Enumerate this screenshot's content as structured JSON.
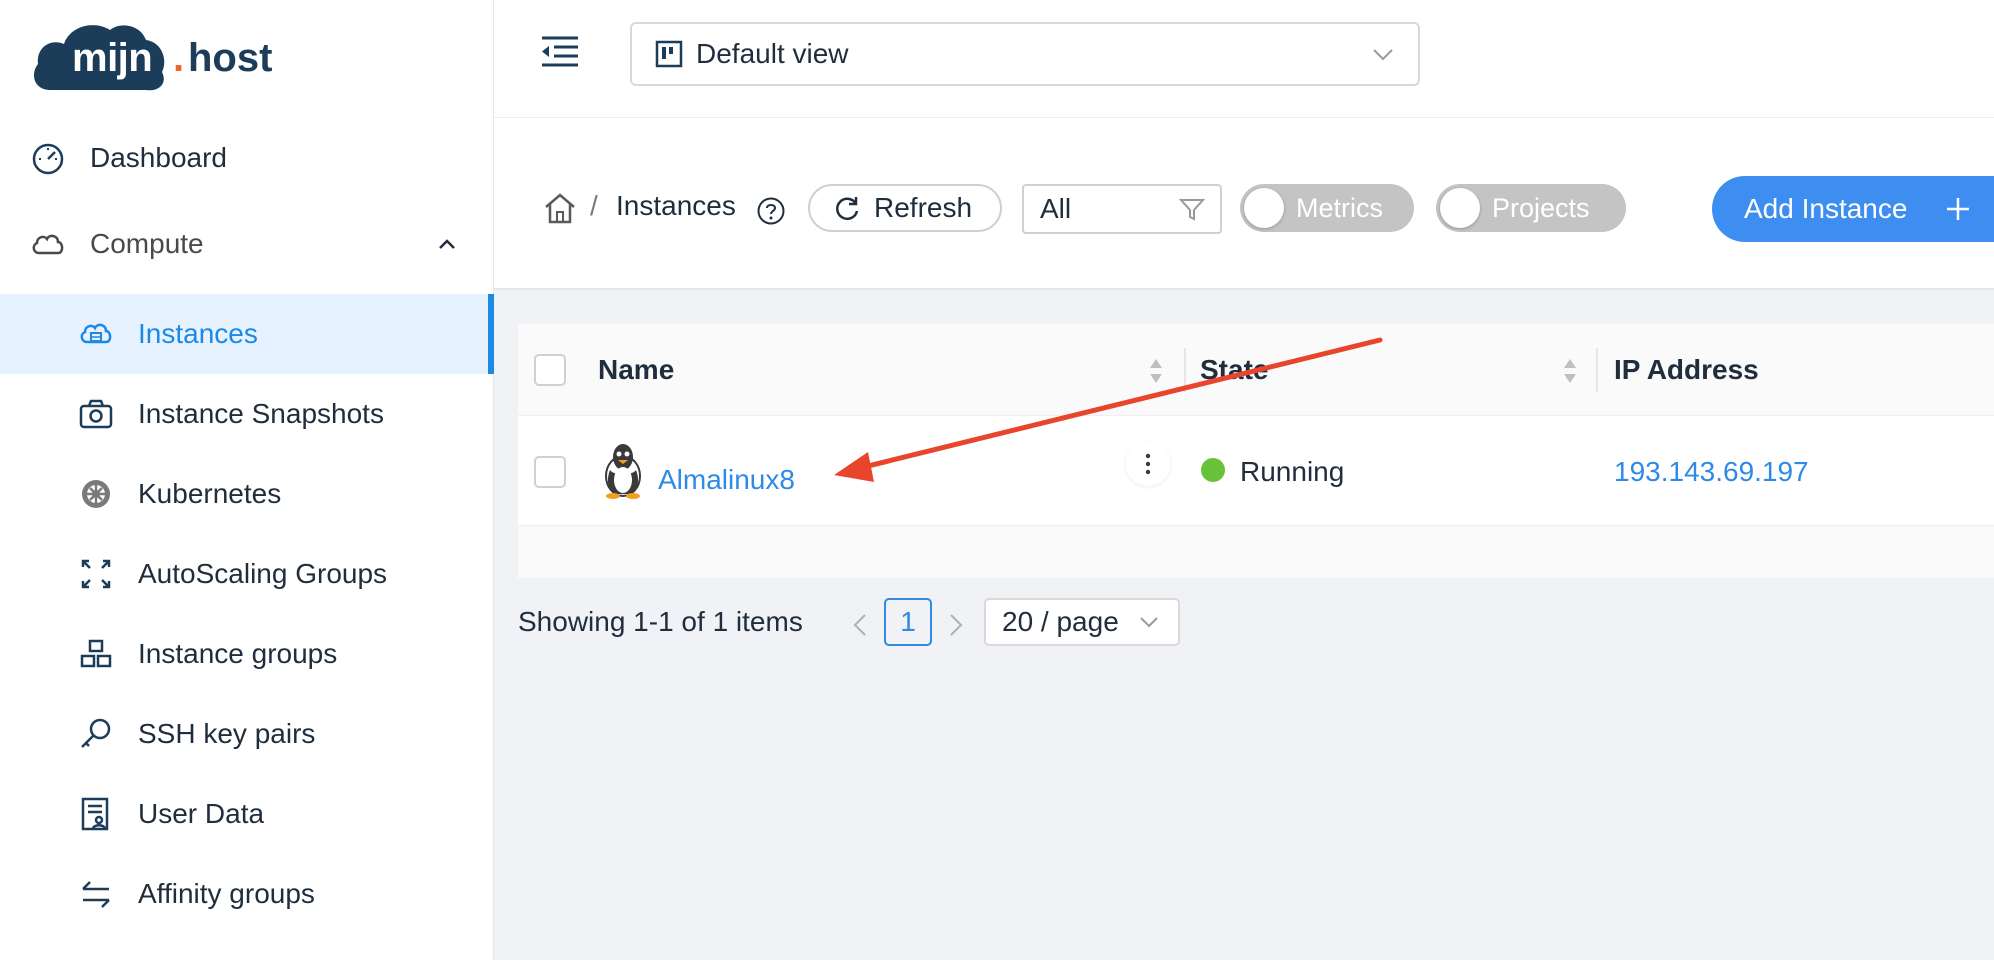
{
  "brand": {
    "name": "mijn",
    "dot": ".",
    "suffix": "host"
  },
  "sidebar": {
    "items": [
      {
        "label": "Dashboard",
        "icon": "dashboard-gauge-icon"
      },
      {
        "label": "Compute",
        "icon": "cloud-icon",
        "expanded": true
      },
      {
        "label": "Instances",
        "icon": "cloud-server-icon",
        "active": true
      },
      {
        "label": "Instance Snapshots",
        "icon": "camera-icon"
      },
      {
        "label": "Kubernetes",
        "icon": "helm-wheel-icon"
      },
      {
        "label": "AutoScaling Groups",
        "icon": "expand-arrows-icon"
      },
      {
        "label": "Instance groups",
        "icon": "cluster-icon"
      },
      {
        "label": "SSH key pairs",
        "icon": "key-icon"
      },
      {
        "label": "User Data",
        "icon": "user-document-icon"
      },
      {
        "label": "Affinity groups",
        "icon": "swap-arrows-icon"
      }
    ]
  },
  "topbar": {
    "view_label": "Default view"
  },
  "toolbar": {
    "breadcrumb_sep": "/",
    "breadcrumb_current": "Instances",
    "refresh_label": "Refresh",
    "filter_value": "All",
    "metrics_label": "Metrics",
    "projects_label": "Projects",
    "add_label": "Add Instance"
  },
  "table": {
    "headers": {
      "name": "Name",
      "state": "State",
      "ip": "IP Address"
    },
    "rows": [
      {
        "name": "Almalinux8",
        "state": "Running",
        "ip": "193.143.69.197",
        "os_icon": "linux-penguin-icon"
      }
    ]
  },
  "pagination": {
    "summary": "Showing 1-1 of 1 items",
    "current_page": "1",
    "page_size": "20 / page"
  },
  "colors": {
    "accent": "#2e8ae6",
    "primary_button": "#3d8ef0",
    "running": "#67c23a",
    "annotation_arrow": "#e8452c",
    "brand_dark": "#1c3d5a",
    "brand_orange": "#e9672d"
  }
}
